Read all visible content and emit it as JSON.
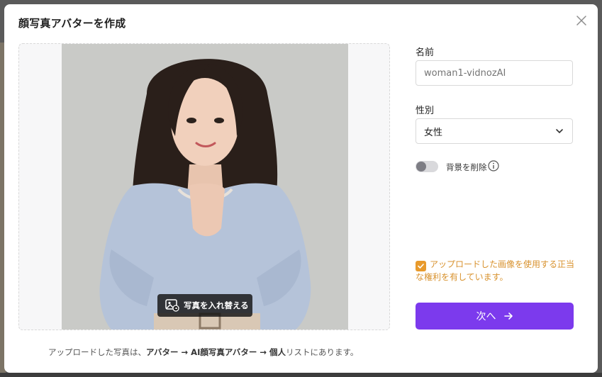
{
  "dialog": {
    "title": "顔写真アバターを作成"
  },
  "upload": {
    "replace_button_label": "写真を入れ替える",
    "note_prefix": "アップロードした写真は、",
    "note_path": "アバター → AI顔写真アバター → 個人",
    "note_suffix": "リストにあります。"
  },
  "form": {
    "name_label": "名前",
    "name_placeholder": "woman1-vidnozAI",
    "gender_label": "性別",
    "gender_value": "女性",
    "remove_bg_label": "背景を削除",
    "remove_bg_enabled": false,
    "consent_checked": true,
    "consent_text": "アップロードした画像を使用する正当な権利を有しています。",
    "next_button_label": "次へ"
  },
  "colors": {
    "accent": "#7c3aed",
    "consent": "#d8922e"
  },
  "icons": [
    "close-icon",
    "image-replace-icon",
    "chevron-down-icon",
    "info-icon",
    "check-icon",
    "arrow-right-icon"
  ]
}
